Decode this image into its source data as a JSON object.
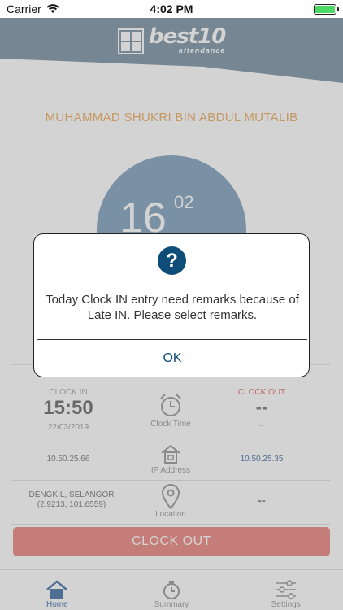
{
  "status_bar": {
    "carrier": "Carrier",
    "time": "4:02 PM"
  },
  "user": {
    "name": "MUHAMMAD SHUKRI BIN ABDUL MUTALIB"
  },
  "clock": {
    "hour": "16",
    "minute": "02"
  },
  "clock_in": {
    "label": "CLOCK IN",
    "time": "15:50",
    "date": "22/03/2019",
    "ip": "10.50.25.66",
    "location_line1": "DENGKIL, SELANGOR",
    "location_line2": "(2.9213, 101.6559)"
  },
  "clock_out": {
    "label": "CLOCK OUT",
    "time": "--",
    "date": "--",
    "ip": "10.50.25.35",
    "location": "--"
  },
  "labels": {
    "clock_time": "Clock Time",
    "ip_address": "IP Address",
    "location": "Location"
  },
  "clock_out_button": "CLOCK OUT",
  "tabs": [
    {
      "label": "Home"
    },
    {
      "label": "Summary"
    },
    {
      "label": "Settings"
    }
  ],
  "alert": {
    "message": "Today Clock IN entry need remarks because of Late IN. Please select remarks.",
    "ok_label": "OK"
  },
  "colors": {
    "primary": "#0e4d78",
    "header": "#6a8598",
    "clock_circle": "#6e93b5",
    "accent_orange": "#e8a04a",
    "danger": "#e8746e"
  }
}
